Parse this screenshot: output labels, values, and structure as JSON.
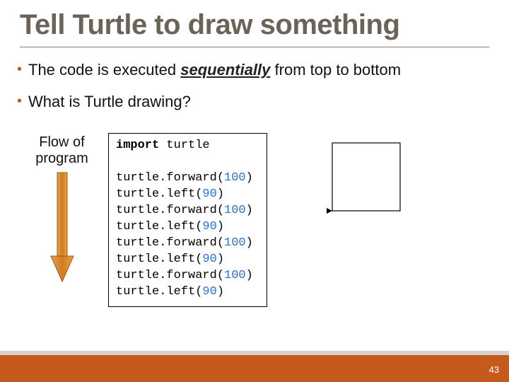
{
  "title": "Tell Turtle to draw something",
  "bullets": {
    "b1_pre": "The code is executed ",
    "b1_em": "sequentially",
    "b1_post": " from top to bottom",
    "b2": "What is Turtle drawing?"
  },
  "flow": {
    "line1": "Flow of",
    "line2": "program"
  },
  "code": {
    "import_kw": "import",
    "import_mod": " turtle",
    "lines": [
      {
        "call": "turtle.forward(",
        "arg": "100",
        "end": ")"
      },
      {
        "call": "turtle.left(",
        "arg": "90",
        "end": ")"
      },
      {
        "call": "turtle.forward(",
        "arg": "100",
        "end": ")"
      },
      {
        "call": "turtle.left(",
        "arg": "90",
        "end": ")"
      },
      {
        "call": "turtle.forward(",
        "arg": "100",
        "end": ")"
      },
      {
        "call": "turtle.left(",
        "arg": "90",
        "end": ")"
      },
      {
        "call": "turtle.forward(",
        "arg": "100",
        "end": ")"
      },
      {
        "call": "turtle.left(",
        "arg": "90",
        "end": ")"
      }
    ]
  },
  "page_number": "43"
}
